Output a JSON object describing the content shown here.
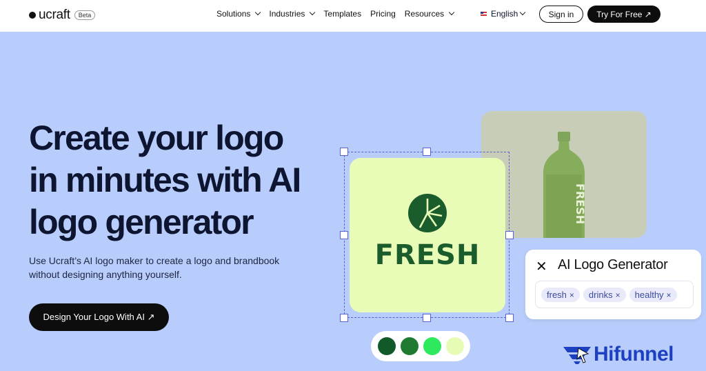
{
  "header": {
    "brand": "ucraft",
    "beta_badge": "Beta",
    "nav": [
      {
        "label": "Solutions",
        "has_dropdown": true
      },
      {
        "label": "Industries",
        "has_dropdown": true
      },
      {
        "label": "Templates",
        "has_dropdown": false
      },
      {
        "label": "Pricing",
        "has_dropdown": false
      },
      {
        "label": "Resources",
        "has_dropdown": true
      }
    ],
    "language": "English",
    "signin_label": "Sign in",
    "try_label": "Try For Free ↗"
  },
  "hero": {
    "title_lines": [
      "Create your logo",
      "in minutes with AI",
      "logo generator"
    ],
    "subtitle_lines": [
      "Use Ucraft’s AI logo maker to create a logo and brandbook",
      "without designing anything yourself."
    ],
    "cta_label": "Design Your Logo With AI ↗"
  },
  "preview": {
    "logo_word": "FRESH",
    "bottle_text": "FRESH",
    "ai_panel": {
      "close_icon": "close-icon",
      "title": "AI Logo Generator",
      "tags": [
        {
          "label": "fresh",
          "remove": "×"
        },
        {
          "label": "drinks",
          "remove": "×"
        },
        {
          "label": "healthy",
          "remove": "×"
        }
      ]
    },
    "swatches": [
      "#0f5a28",
      "#1f7a32",
      "#2ee85e",
      "#e6fcb5"
    ]
  },
  "colors": {
    "background": "#b8cdfb",
    "heading": "#0e1530",
    "logo_green": "#1a5c2b",
    "card_bg": "#e8fbb7",
    "selection": "#5b5fd6"
  },
  "watermark": {
    "text": "Hifunnel"
  }
}
